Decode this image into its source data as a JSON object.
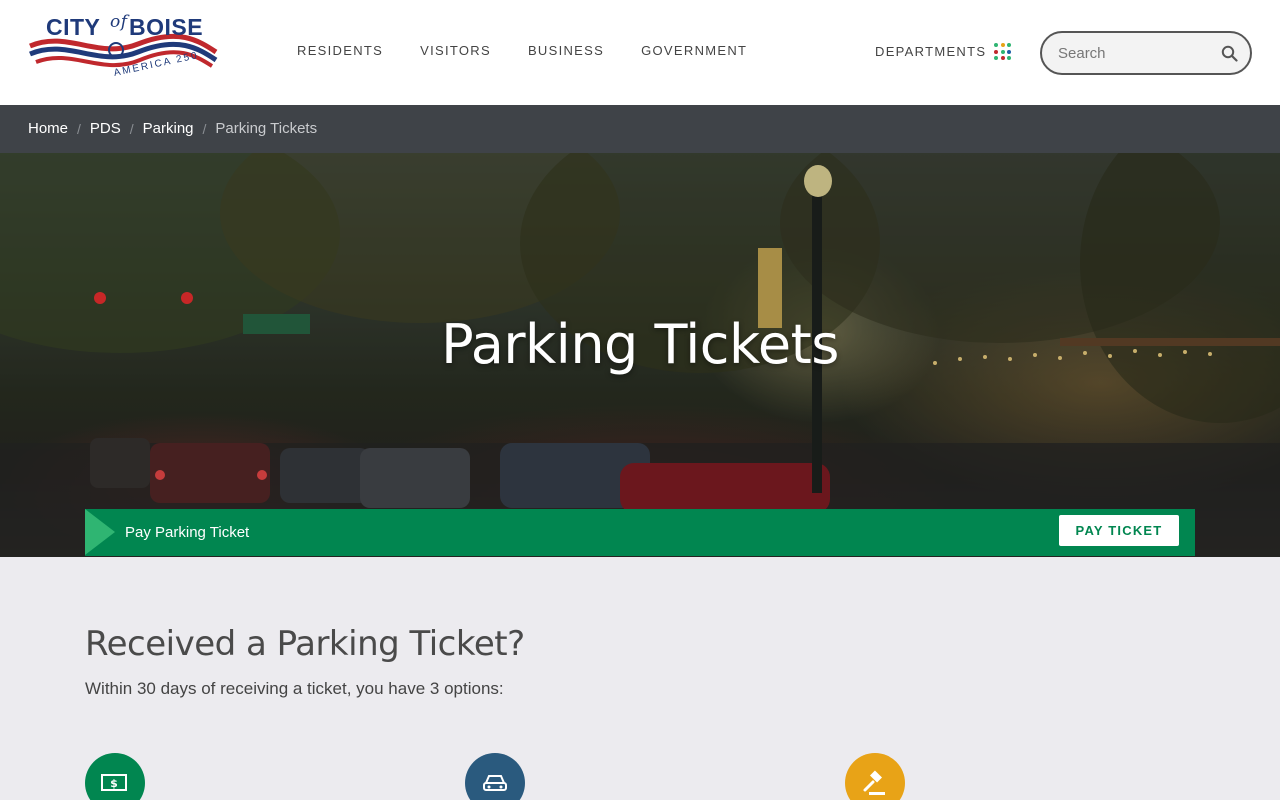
{
  "logo": {
    "city": "CITY",
    "of": "of",
    "boise": "BOISE",
    "tagline": "AMERICA 250"
  },
  "nav": {
    "items": [
      "RESIDENTS",
      "VISITORS",
      "BUSINESS",
      "GOVERNMENT"
    ],
    "departments": "DEPARTMENTS"
  },
  "search": {
    "placeholder": "Search"
  },
  "breadcrumb": {
    "items": [
      "Home",
      "PDS",
      "Parking"
    ],
    "current": "Parking Tickets"
  },
  "hero": {
    "title": "Parking Tickets"
  },
  "paybar": {
    "text": "Pay Parking Ticket",
    "button": "PAY TICKET"
  },
  "content": {
    "heading": "Received a Parking Ticket?",
    "intro": "Within 30 days of receiving a ticket, you have 3 options:"
  },
  "options": [
    {
      "icon": "money-icon",
      "color": "#018650"
    },
    {
      "icon": "car-icon",
      "color": "#2a5a7e"
    },
    {
      "icon": "gavel-icon",
      "color": "#e8a317"
    }
  ],
  "colors": {
    "accent": "#018650",
    "breadcrumb_bg": "#3f4348",
    "brand_blue": "#1f3a7a",
    "brand_red": "#c0282d"
  }
}
